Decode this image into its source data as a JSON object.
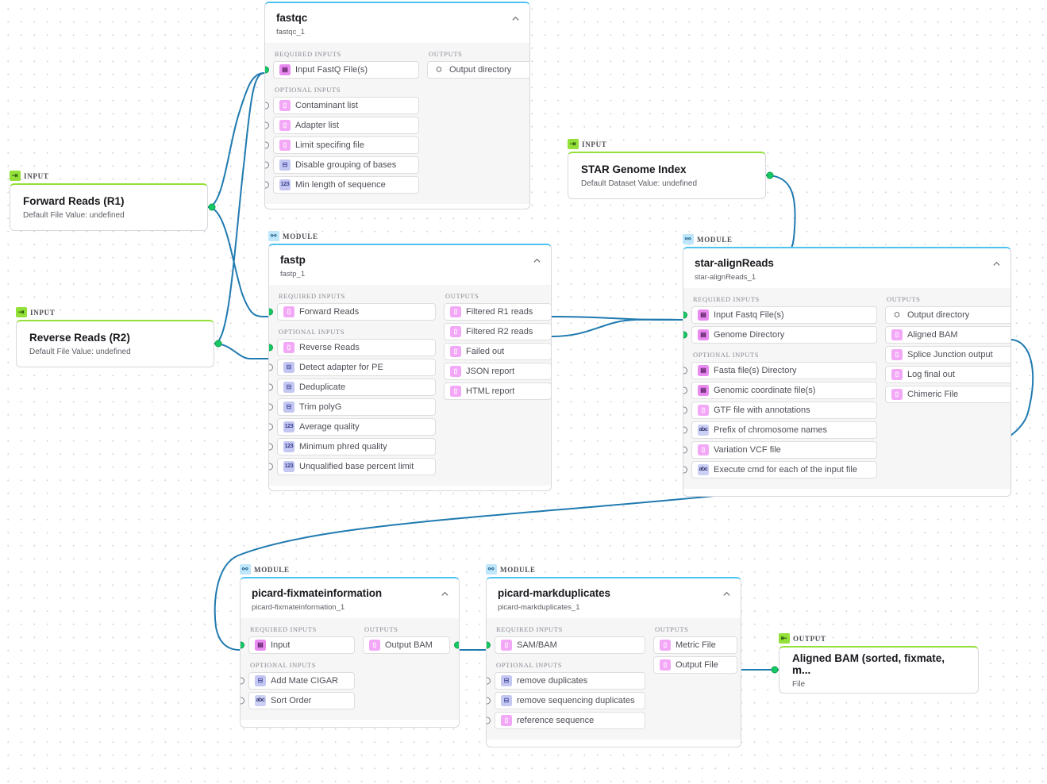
{
  "canvas": {
    "grid": true,
    "bg": "#ffffff",
    "grid_dot_color": "#d7d7dd"
  },
  "colors": {
    "module_accent": "#4ec3f0",
    "io_accent": "#92e038",
    "wire": "#1f7ab0",
    "connected_port": "#17c964",
    "open_port": "#7d7d86",
    "file_icon": "#f3a8f7",
    "dir_icon": "#e98bf0",
    "bool_icon": "#c3c7f2",
    "number_icon": "#c3c7f2",
    "string_icon": "#ccd0f4"
  },
  "labels": {
    "module_badge": "MODULE",
    "input_badge": "INPUT",
    "output_badge": "OUTPUT",
    "required_inputs": "REQUIRED INPUTS",
    "optional_inputs": "OPTIONAL INPUTS",
    "outputs": "OUTPUTS",
    "collapse_icon": "chevron-up-icon"
  },
  "nodes": {
    "input_forward_reads": {
      "badge": "INPUT",
      "title": "Forward Reads (R1)",
      "subtitle": "Default File Value: undefined"
    },
    "input_reverse_reads": {
      "badge": "INPUT",
      "title": "Reverse Reads (R2)",
      "subtitle": "Default File Value: undefined"
    },
    "input_star_genome_index": {
      "badge": "INPUT",
      "title": "STAR Genome Index",
      "subtitle": "Default Dataset Value: undefined"
    },
    "output_aligned_bam": {
      "badge": "OUTPUT",
      "title": "Aligned BAM (sorted, fixmate, m...",
      "subtitle": "File"
    },
    "fastqc": {
      "badge": "MODULE",
      "title": "fastqc",
      "subtitle": "fastqc_1",
      "required_inputs": [
        {
          "label": "Input FastQ File(s)",
          "icon": "dir",
          "connected": true
        }
      ],
      "optional_inputs": [
        {
          "label": "Contaminant list",
          "icon": "file",
          "connected": false
        },
        {
          "label": "Adapter list",
          "icon": "file",
          "connected": false
        },
        {
          "label": "Limit specifing file",
          "icon": "file",
          "connected": false
        },
        {
          "label": "Disable grouping of bases",
          "icon": "bool",
          "connected": false
        },
        {
          "label": "Min length of sequence",
          "icon": "num",
          "connected": false
        }
      ],
      "outputs": [
        {
          "label": "Output directory",
          "icon": "out",
          "connected": false
        }
      ]
    },
    "fastp": {
      "badge": "MODULE",
      "title": "fastp",
      "subtitle": "fastp_1",
      "required_inputs": [
        {
          "label": "Forward Reads",
          "icon": "file",
          "connected": true
        }
      ],
      "optional_inputs": [
        {
          "label": "Reverse Reads",
          "icon": "file",
          "connected": true
        },
        {
          "label": "Detect adapter for PE",
          "icon": "bool",
          "connected": false
        },
        {
          "label": "Deduplicate",
          "icon": "bool",
          "connected": false
        },
        {
          "label": "Trim polyG",
          "icon": "bool",
          "connected": false
        },
        {
          "label": "Average quality",
          "icon": "num",
          "connected": false
        },
        {
          "label": "Minimum phred quality",
          "icon": "num",
          "connected": false
        },
        {
          "label": "Unqualified base percent limit",
          "icon": "num",
          "connected": false
        }
      ],
      "outputs": [
        {
          "label": "Filtered R1 reads",
          "icon": "file",
          "connected": true
        },
        {
          "label": "Filtered R2 reads",
          "icon": "file",
          "connected": true
        },
        {
          "label": "Failed out",
          "icon": "file",
          "connected": false
        },
        {
          "label": "JSON report",
          "icon": "file",
          "connected": false
        },
        {
          "label": "HTML report",
          "icon": "file",
          "connected": false
        }
      ]
    },
    "star_alignreads": {
      "badge": "MODULE",
      "title": "star-alignReads",
      "subtitle": "star-alignReads_1",
      "required_inputs": [
        {
          "label": "Input Fastq File(s)",
          "icon": "dir",
          "connected": true
        },
        {
          "label": "Genome Directory",
          "icon": "dir",
          "connected": true
        }
      ],
      "optional_inputs": [
        {
          "label": "Fasta file(s) Directory",
          "icon": "dir",
          "connected": false
        },
        {
          "label": "Genomic coordinate file(s)",
          "icon": "dir",
          "connected": false
        },
        {
          "label": "GTF file with annotations",
          "icon": "file",
          "connected": false
        },
        {
          "label": "Prefix of chromosome names",
          "icon": "str",
          "connected": false
        },
        {
          "label": "Variation VCF file",
          "icon": "file",
          "connected": false
        },
        {
          "label": "Execute cmd for each of the input file",
          "icon": "str",
          "connected": false
        }
      ],
      "outputs": [
        {
          "label": "Output directory",
          "icon": "out",
          "connected": false
        },
        {
          "label": "Aligned BAM",
          "icon": "file",
          "connected": true
        },
        {
          "label": "Splice Junction output",
          "icon": "file",
          "connected": false
        },
        {
          "label": "Log final out",
          "icon": "file",
          "connected": false
        },
        {
          "label": "Chimeric File",
          "icon": "file",
          "connected": false
        }
      ]
    },
    "picard_fixmateinformation": {
      "badge": "MODULE",
      "title": "picard-fixmateinformation",
      "subtitle": "picard-fixmateinformation_1",
      "required_inputs": [
        {
          "label": "Input",
          "icon": "dir",
          "connected": true
        }
      ],
      "optional_inputs": [
        {
          "label": "Add Mate CIGAR",
          "icon": "bool",
          "connected": false
        },
        {
          "label": "Sort Order",
          "icon": "str",
          "connected": false
        }
      ],
      "outputs": [
        {
          "label": "Output BAM",
          "icon": "file",
          "connected": true
        }
      ]
    },
    "picard_markduplicates": {
      "badge": "MODULE",
      "title": "picard-markduplicates",
      "subtitle": "picard-markduplicates_1",
      "required_inputs": [
        {
          "label": "SAM/BAM",
          "icon": "file",
          "connected": true
        }
      ],
      "optional_inputs": [
        {
          "label": "remove duplicates",
          "icon": "bool",
          "connected": false
        },
        {
          "label": "remove sequencing duplicates",
          "icon": "bool",
          "connected": false
        },
        {
          "label": "reference sequence",
          "icon": "file",
          "connected": false
        }
      ],
      "outputs": [
        {
          "label": "Metric File",
          "icon": "file",
          "connected": false
        },
        {
          "label": "Output File",
          "icon": "file",
          "connected": true
        }
      ]
    }
  },
  "edges": [
    {
      "from": "input_forward_reads",
      "to": "fastqc.Input FastQ File(s)"
    },
    {
      "from": "input_forward_reads",
      "to": "fastp.Forward Reads"
    },
    {
      "from": "input_reverse_reads",
      "to": "fastqc.Input FastQ File(s)"
    },
    {
      "from": "input_reverse_reads",
      "to": "fastp.Reverse Reads"
    },
    {
      "from": "fastp.Filtered R1 reads",
      "to": "star_alignreads.Input Fastq File(s)"
    },
    {
      "from": "fastp.Filtered R2 reads",
      "to": "star_alignreads.Input Fastq File(s)"
    },
    {
      "from": "input_star_genome_index",
      "to": "star_alignreads.Genome Directory"
    },
    {
      "from": "star_alignreads.Aligned BAM",
      "to": "picard_fixmateinformation.Input"
    },
    {
      "from": "picard_fixmateinformation.Output BAM",
      "to": "picard_markduplicates.SAM/BAM"
    },
    {
      "from": "picard_markduplicates.Output File",
      "to": "output_aligned_bam"
    }
  ]
}
